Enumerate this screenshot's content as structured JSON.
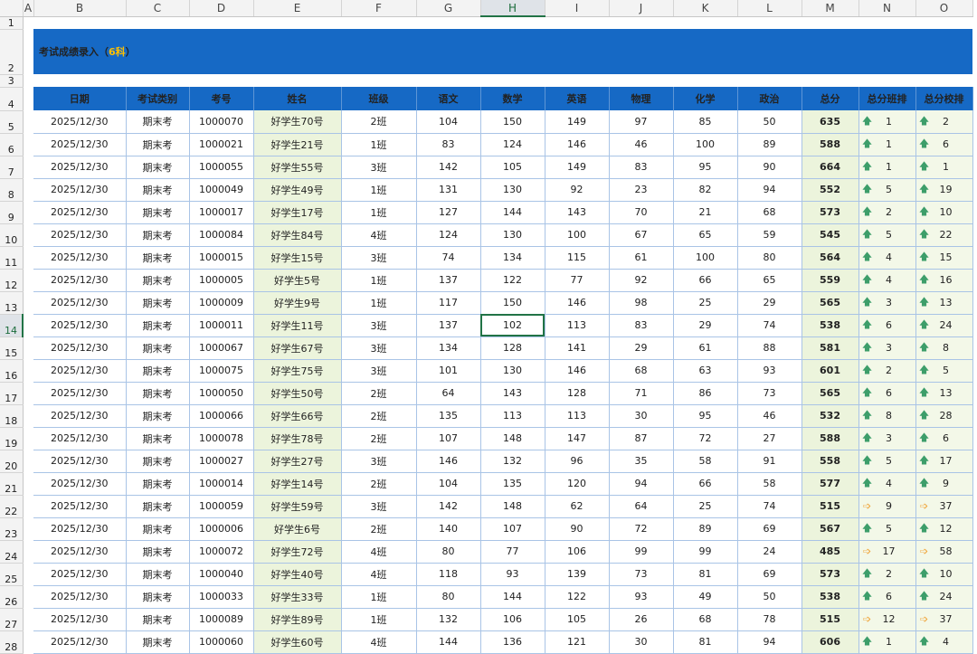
{
  "columns": [
    "A",
    "B",
    "C",
    "D",
    "E",
    "F",
    "G",
    "H",
    "I",
    "J",
    "K",
    "L",
    "M",
    "N",
    "O"
  ],
  "selected_column": "H",
  "selected_row": "14",
  "title_main": "考试成绩录入（",
  "title_highlight": "6科",
  "title_end": "）",
  "row_numbers": [
    "1",
    "2",
    "3",
    "4",
    "5",
    "6",
    "7",
    "8",
    "9",
    "10",
    "11",
    "12",
    "13",
    "14",
    "15",
    "16",
    "17",
    "18",
    "19",
    "20",
    "21",
    "22",
    "23",
    "24",
    "25",
    "26",
    "27",
    "28"
  ],
  "headers": [
    "日期",
    "考试类别",
    "考号",
    "姓名",
    "班级",
    "语文",
    "数学",
    "英语",
    "物理",
    "化学",
    "政治",
    "总分",
    "总分班排",
    "总分校排"
  ],
  "icons": {
    "up": "arrow-up-icon",
    "right": "arrow-right-icon"
  },
  "rows": [
    [
      "2025/12/30",
      "期末考",
      "1000070",
      "好学生70号",
      "2班",
      "104",
      "150",
      "149",
      "97",
      "85",
      "50",
      "635",
      "up",
      "1",
      "up",
      "2"
    ],
    [
      "2025/12/30",
      "期末考",
      "1000021",
      "好学生21号",
      "1班",
      "83",
      "124",
      "146",
      "46",
      "100",
      "89",
      "588",
      "up",
      "1",
      "up",
      "6"
    ],
    [
      "2025/12/30",
      "期末考",
      "1000055",
      "好学生55号",
      "3班",
      "142",
      "105",
      "149",
      "83",
      "95",
      "90",
      "664",
      "up",
      "1",
      "up",
      "1"
    ],
    [
      "2025/12/30",
      "期末考",
      "1000049",
      "好学生49号",
      "1班",
      "131",
      "130",
      "92",
      "23",
      "82",
      "94",
      "552",
      "up",
      "5",
      "up",
      "19"
    ],
    [
      "2025/12/30",
      "期末考",
      "1000017",
      "好学生17号",
      "1班",
      "127",
      "144",
      "143",
      "70",
      "21",
      "68",
      "573",
      "up",
      "2",
      "up",
      "10"
    ],
    [
      "2025/12/30",
      "期末考",
      "1000084",
      "好学生84号",
      "4班",
      "124",
      "130",
      "100",
      "67",
      "65",
      "59",
      "545",
      "up",
      "5",
      "up",
      "22"
    ],
    [
      "2025/12/30",
      "期末考",
      "1000015",
      "好学生15号",
      "3班",
      "74",
      "134",
      "115",
      "61",
      "100",
      "80",
      "564",
      "up",
      "4",
      "up",
      "15"
    ],
    [
      "2025/12/30",
      "期末考",
      "1000005",
      "好学生5号",
      "1班",
      "137",
      "122",
      "77",
      "92",
      "66",
      "65",
      "559",
      "up",
      "4",
      "up",
      "16"
    ],
    [
      "2025/12/30",
      "期末考",
      "1000009",
      "好学生9号",
      "1班",
      "117",
      "150",
      "146",
      "98",
      "25",
      "29",
      "565",
      "up",
      "3",
      "up",
      "13"
    ],
    [
      "2025/12/30",
      "期末考",
      "1000011",
      "好学生11号",
      "3班",
      "137",
      "102",
      "113",
      "83",
      "29",
      "74",
      "538",
      "up",
      "6",
      "up",
      "24"
    ],
    [
      "2025/12/30",
      "期末考",
      "1000067",
      "好学生67号",
      "3班",
      "134",
      "128",
      "141",
      "29",
      "61",
      "88",
      "581",
      "up",
      "3",
      "up",
      "8"
    ],
    [
      "2025/12/30",
      "期末考",
      "1000075",
      "好学生75号",
      "3班",
      "101",
      "130",
      "146",
      "68",
      "63",
      "93",
      "601",
      "up",
      "2",
      "up",
      "5"
    ],
    [
      "2025/12/30",
      "期末考",
      "1000050",
      "好学生50号",
      "2班",
      "64",
      "143",
      "128",
      "71",
      "86",
      "73",
      "565",
      "up",
      "6",
      "up",
      "13"
    ],
    [
      "2025/12/30",
      "期末考",
      "1000066",
      "好学生66号",
      "2班",
      "135",
      "113",
      "113",
      "30",
      "95",
      "46",
      "532",
      "up",
      "8",
      "up",
      "28"
    ],
    [
      "2025/12/30",
      "期末考",
      "1000078",
      "好学生78号",
      "2班",
      "107",
      "148",
      "147",
      "87",
      "72",
      "27",
      "588",
      "up",
      "3",
      "up",
      "6"
    ],
    [
      "2025/12/30",
      "期末考",
      "1000027",
      "好学生27号",
      "3班",
      "146",
      "132",
      "96",
      "35",
      "58",
      "91",
      "558",
      "up",
      "5",
      "up",
      "17"
    ],
    [
      "2025/12/30",
      "期末考",
      "1000014",
      "好学生14号",
      "2班",
      "104",
      "135",
      "120",
      "94",
      "66",
      "58",
      "577",
      "up",
      "4",
      "up",
      "9"
    ],
    [
      "2025/12/30",
      "期末考",
      "1000059",
      "好学生59号",
      "3班",
      "142",
      "148",
      "62",
      "64",
      "25",
      "74",
      "515",
      "right",
      "9",
      "right",
      "37"
    ],
    [
      "2025/12/30",
      "期末考",
      "1000006",
      "好学生6号",
      "2班",
      "140",
      "107",
      "90",
      "72",
      "89",
      "69",
      "567",
      "up",
      "5",
      "up",
      "12"
    ],
    [
      "2025/12/30",
      "期末考",
      "1000072",
      "好学生72号",
      "4班",
      "80",
      "77",
      "106",
      "99",
      "99",
      "24",
      "485",
      "right",
      "17",
      "right",
      "58"
    ],
    [
      "2025/12/30",
      "期末考",
      "1000040",
      "好学生40号",
      "4班",
      "118",
      "93",
      "139",
      "73",
      "81",
      "69",
      "573",
      "up",
      "2",
      "up",
      "10"
    ],
    [
      "2025/12/30",
      "期末考",
      "1000033",
      "好学生33号",
      "1班",
      "80",
      "144",
      "122",
      "93",
      "49",
      "50",
      "538",
      "up",
      "6",
      "up",
      "24"
    ],
    [
      "2025/12/30",
      "期末考",
      "1000089",
      "好学生89号",
      "1班",
      "132",
      "106",
      "105",
      "26",
      "68",
      "78",
      "515",
      "right",
      "12",
      "right",
      "37"
    ],
    [
      "2025/12/30",
      "期末考",
      "1000060",
      "好学生60号",
      "4班",
      "144",
      "136",
      "121",
      "30",
      "81",
      "94",
      "606",
      "up",
      "1",
      "up",
      "4"
    ]
  ]
}
